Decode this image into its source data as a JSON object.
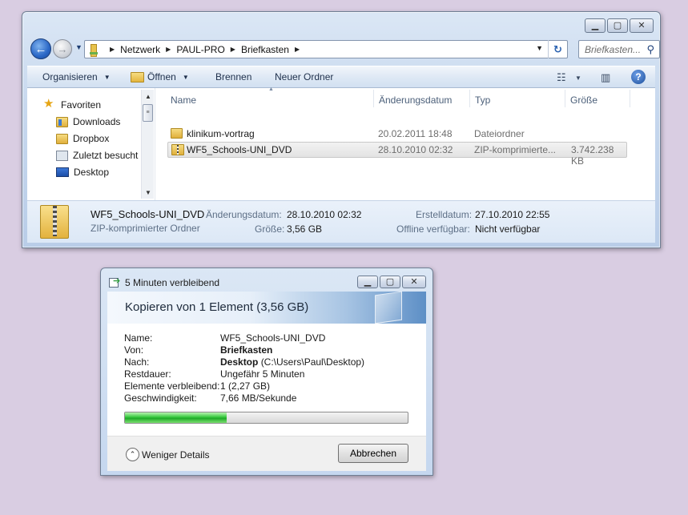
{
  "explorer": {
    "breadcrumb": [
      "Netzwerk",
      "PAUL-PRO",
      "Briefkasten"
    ],
    "search_placeholder": "Briefkasten...",
    "toolbar": {
      "organize": "Organisieren",
      "open": "Öffnen",
      "burn": "Brennen",
      "new_folder": "Neuer Ordner"
    },
    "nav": {
      "favorites": "Favoriten",
      "items": [
        "Downloads",
        "Dropbox",
        "Zuletzt besucht",
        "Desktop"
      ]
    },
    "columns": {
      "name": "Name",
      "date": "Änderungsdatum",
      "type": "Typ",
      "size": "Größe"
    },
    "files": [
      {
        "name": "klinikum-vortrag",
        "date": "20.02.2011 18:48",
        "type": "Dateiordner",
        "size": ""
      },
      {
        "name": "WF5_Schools-UNI_DVD",
        "date": "28.10.2010 02:32",
        "type": "ZIP-komprimierte...",
        "size": "3.742.238 KB"
      }
    ],
    "details": {
      "filename": "WF5_Schools-UNI_DVD",
      "filetype": "ZIP-komprimierter Ordner",
      "modified_label": "Änderungsdatum:",
      "modified_value": "28.10.2010 02:32",
      "size_label": "Größe:",
      "size_value": "3,56 GB",
      "created_label": "Erstelldatum:",
      "created_value": "27.10.2010 22:55",
      "offline_label": "Offline verfügbar:",
      "offline_value": "Nicht verfügbar"
    }
  },
  "copy_dialog": {
    "title": "5 Minuten verbleibend",
    "heading": "Kopieren von 1 Element (3,56 GB)",
    "name_label": "Name:",
    "name_value": "WF5_Schools-UNI_DVD",
    "from_label": "Von:",
    "from_value": "Briefkasten",
    "to_label": "Nach:",
    "to_bold": "Desktop",
    "to_path": "(C:\\Users\\Paul\\Desktop)",
    "remaining_label": "Restdauer:",
    "remaining_value": "Ungefähr 5 Minuten",
    "items_label": "Elemente verbleibend:",
    "items_value": "1 (2,27 GB)",
    "speed_label": "Geschwindigkeit:",
    "speed_value": "7,66 MB/Sekunde",
    "progress_fraction": 0.36,
    "less_details": "Weniger Details",
    "cancel": "Abbrechen"
  }
}
